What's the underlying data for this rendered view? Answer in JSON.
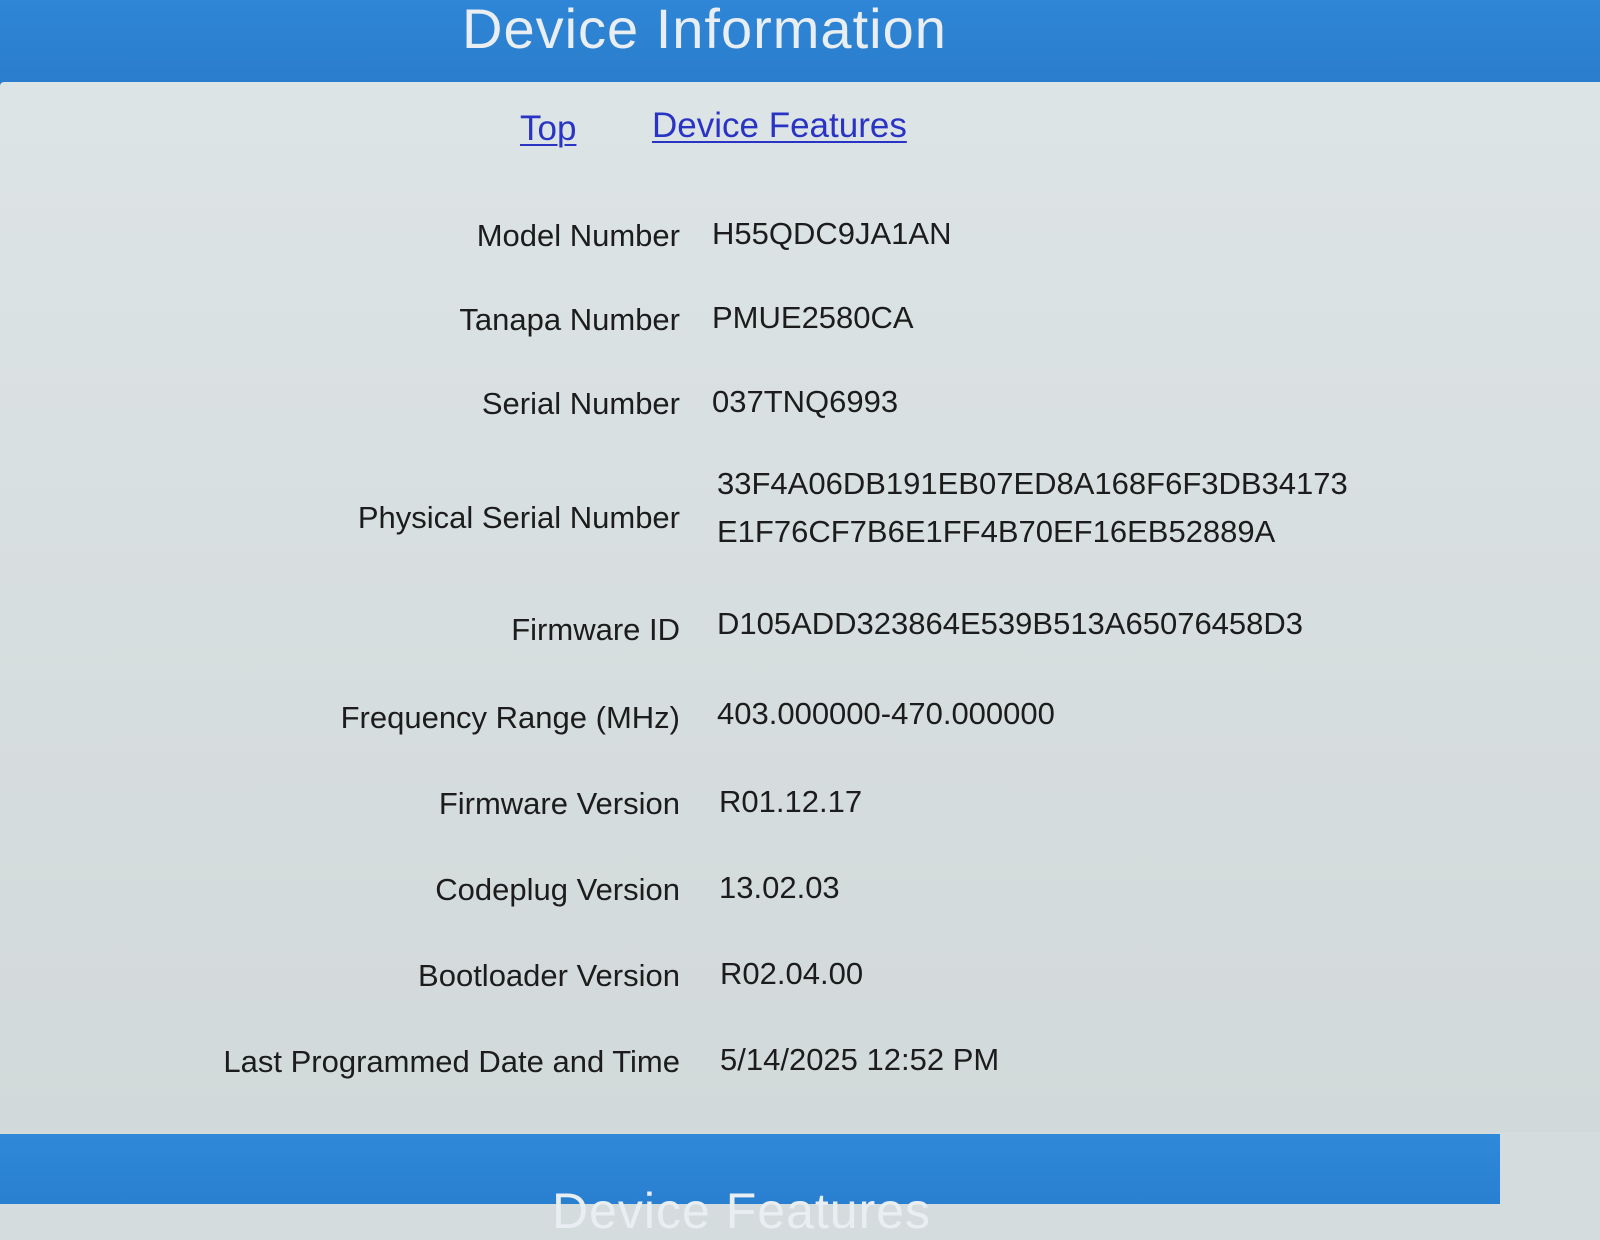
{
  "header": {
    "title": "Device Information"
  },
  "nav": {
    "top_label": "Top",
    "features_label": "Device Features"
  },
  "info": {
    "model_number": {
      "label": "Model Number",
      "value": "H55QDC9JA1AN"
    },
    "tanapa_number": {
      "label": "Tanapa Number",
      "value": "PMUE2580CA"
    },
    "serial_number": {
      "label": "Serial Number",
      "value": "037TNQ6993"
    },
    "physical_serial_number": {
      "label": "Physical Serial Number",
      "value_line1": "33F4A06DB191EB07ED8A168F6F3DB34173",
      "value_line2": "E1F76CF7B6E1FF4B70EF16EB52889A"
    },
    "firmware_id": {
      "label": "Firmware ID",
      "value": "D105ADD323864E539B513A65076458D3"
    },
    "frequency_range": {
      "label": "Frequency Range (MHz)",
      "value": "403.000000-470.000000"
    },
    "firmware_version": {
      "label": "Firmware Version",
      "value": "R01.12.17"
    },
    "codeplug_version": {
      "label": "Codeplug Version",
      "value": "13.02.03"
    },
    "bootloader_version": {
      "label": "Bootloader Version",
      "value": "R02.04.00"
    },
    "last_programmed": {
      "label": "Last Programmed Date and Time",
      "value": "5/14/2025 12:52 PM"
    }
  },
  "footer": {
    "title": "Device Features"
  },
  "colors": {
    "header_blue": "#2f86d6",
    "panel_bg": "#dde4e6",
    "link_blue": "#2a34c4"
  }
}
